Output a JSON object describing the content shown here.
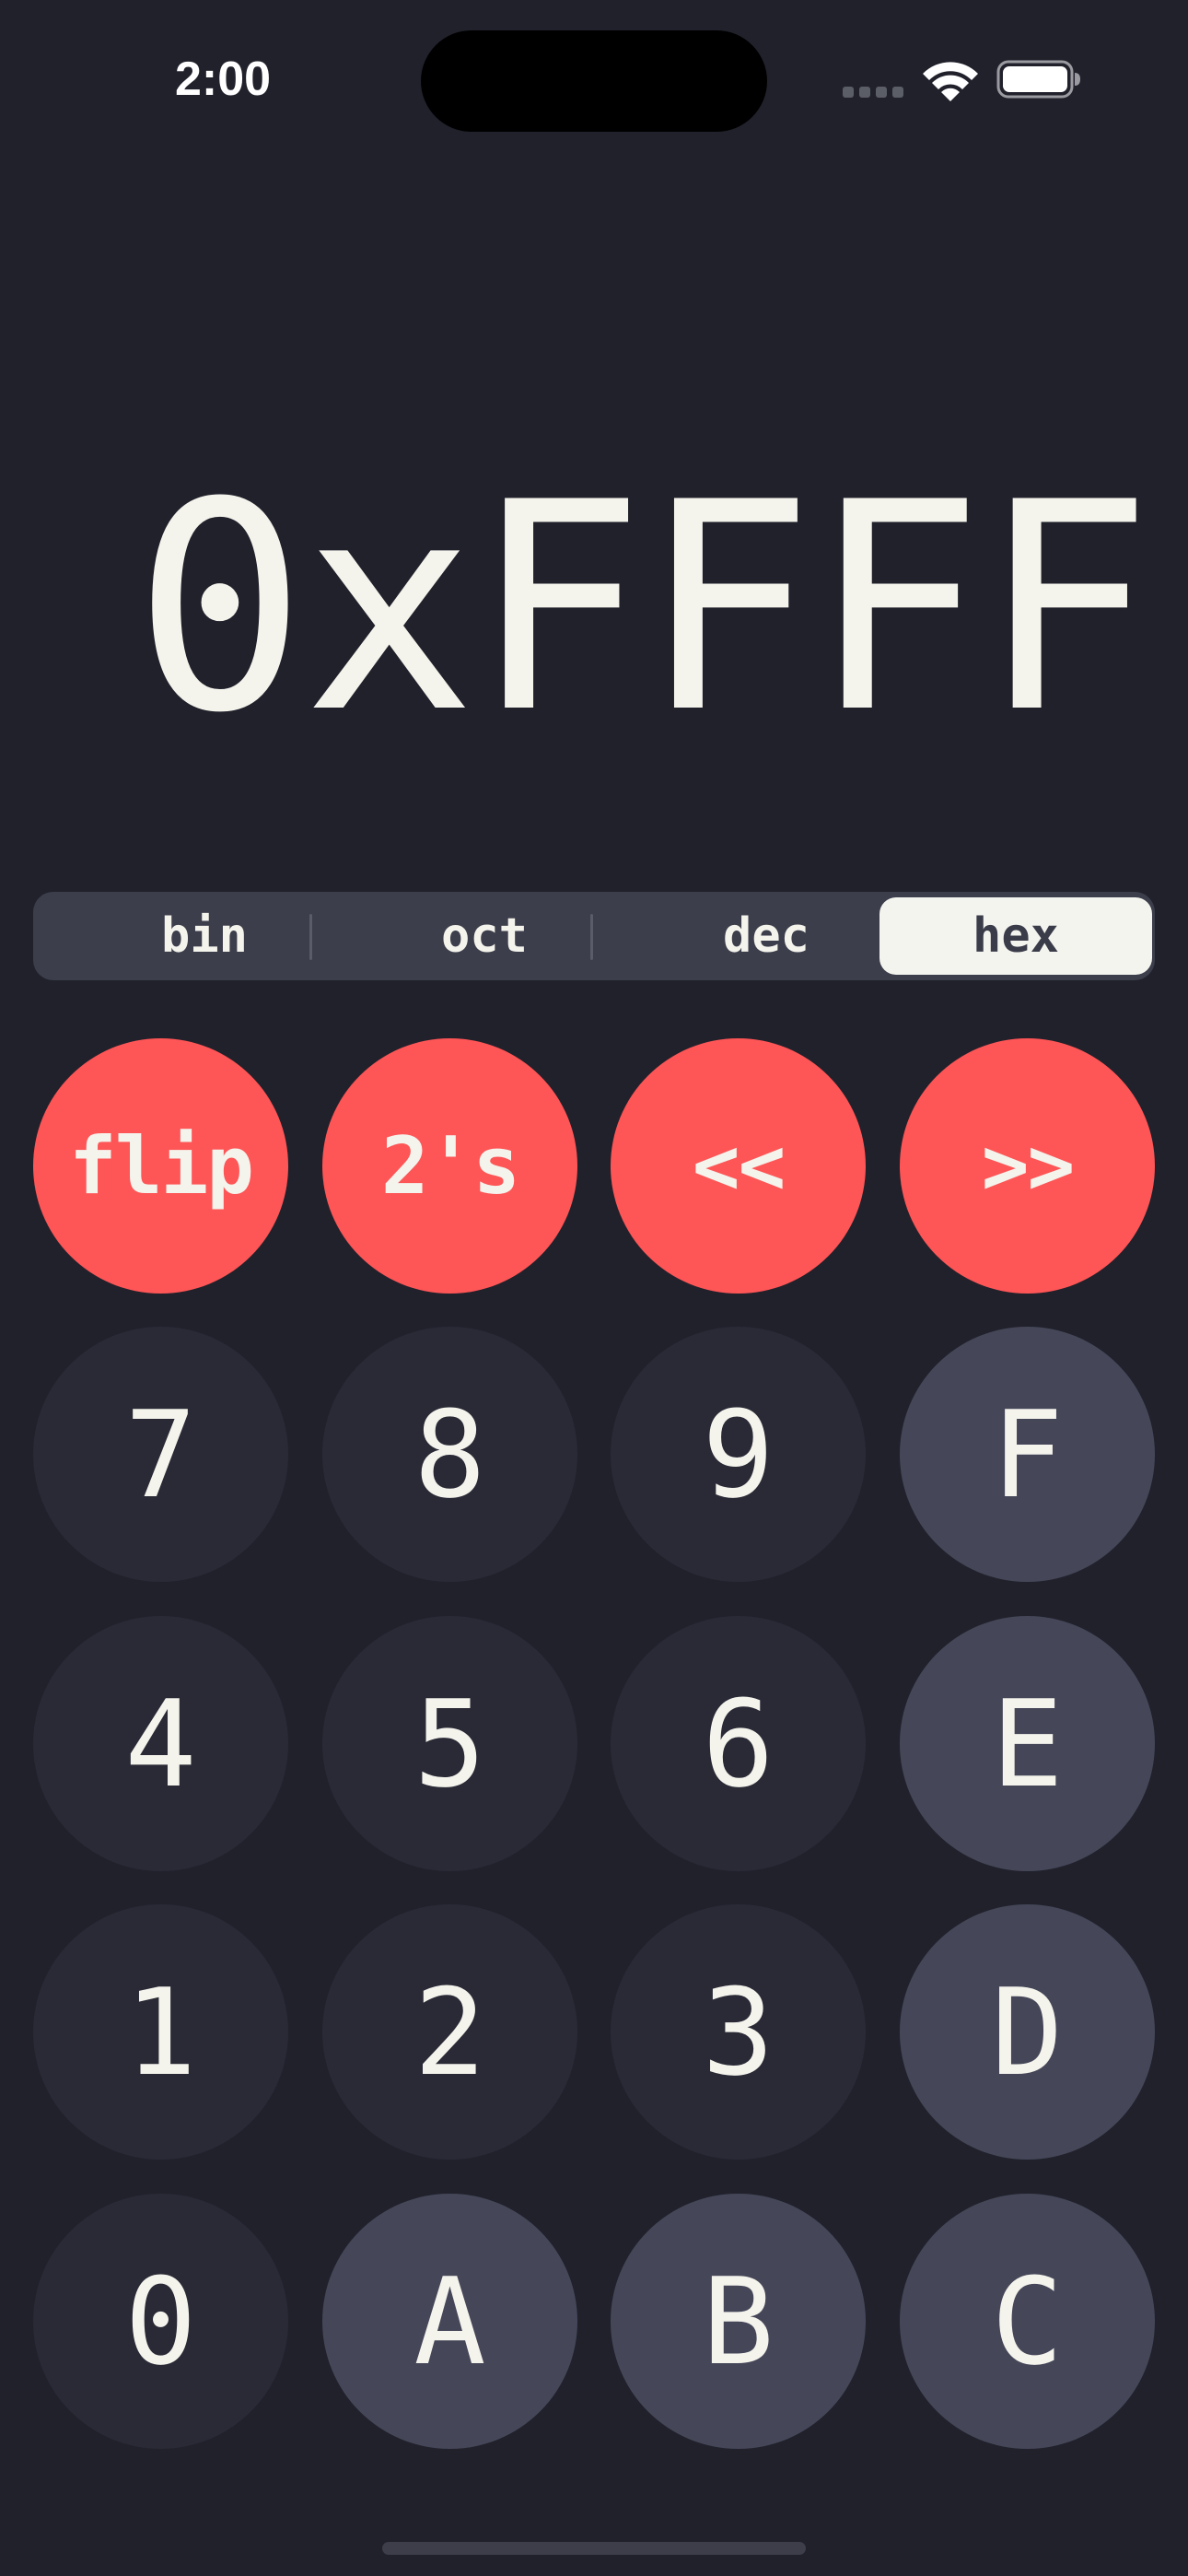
{
  "status_bar": {
    "time": "2:00"
  },
  "display": {
    "value": "0xFFFF"
  },
  "modes": [
    {
      "label": "bin",
      "active": false
    },
    {
      "label": "oct",
      "active": false
    },
    {
      "label": "dec",
      "active": false
    },
    {
      "label": "hex",
      "active": true
    }
  ],
  "keypad": {
    "ops": [
      "flip",
      "2's",
      "<<",
      ">>"
    ],
    "row1": [
      "7",
      "8",
      "9",
      "F"
    ],
    "row2": [
      "4",
      "5",
      "6",
      "E"
    ],
    "row3": [
      "1",
      "2",
      "3",
      "D"
    ],
    "row4": [
      "0",
      "A",
      "B",
      "C"
    ]
  },
  "colors": {
    "background": "#20212b",
    "operator_key": "#fe5556",
    "digit_key": "#292a36",
    "hex_digit_key": "#454759",
    "segmented_bg": "#3c3e4b",
    "segment_active": "#f4f4ef",
    "text": "#f4f3ec"
  },
  "icons": {
    "signal": "cellular-signal-icon",
    "wifi": "wifi-icon",
    "battery": "battery-icon"
  }
}
